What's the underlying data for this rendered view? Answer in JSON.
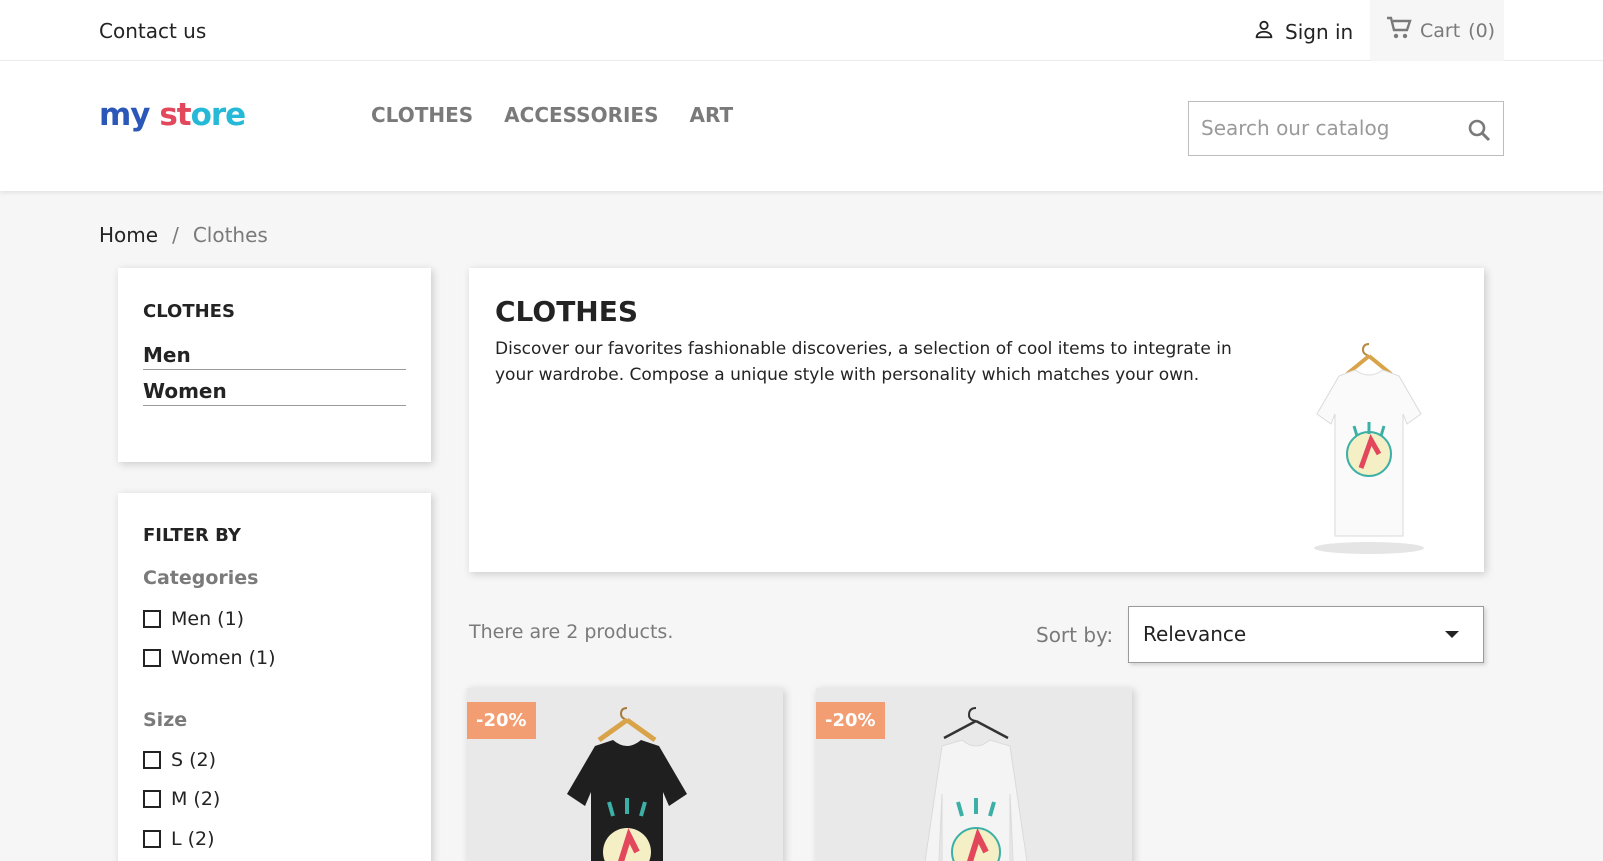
{
  "topnav": {
    "contact": "Contact us",
    "signin": "Sign in",
    "cart": "Cart",
    "cart_count": "(0)"
  },
  "header": {
    "logo": {
      "part1": "my",
      "part2": " ",
      "part3": "st",
      "part4": "ore"
    },
    "menu": [
      "CLOTHES",
      "ACCESSORIES",
      "ART"
    ],
    "search_placeholder": "Search our catalog"
  },
  "breadcrumb": {
    "home": "Home",
    "separator": "/",
    "current": "Clothes"
  },
  "categories_block": {
    "title": "CLOTHES",
    "items": [
      "Men",
      "Women"
    ]
  },
  "filters": {
    "title": "FILTER BY",
    "facets": [
      {
        "title": "Categories",
        "options": [
          "Men (1)",
          "Women (1)"
        ]
      },
      {
        "title": "Size",
        "options": [
          "S (2)",
          "M (2)",
          "L (2)"
        ]
      }
    ]
  },
  "category": {
    "title": "CLOTHES",
    "description": "Discover our favorites fashionable discoveries, a selection of cool items to integrate in your wardrobe. Compose a unique style with personality which matches your own."
  },
  "listing": {
    "count_text": "There are 2 products.",
    "sort_label": "Sort by:",
    "sort_value": "Relevance",
    "products": [
      {
        "badge": "-20%",
        "shirt_color": "#1f1f1f"
      },
      {
        "badge": "-20%",
        "shirt_color": "#f4f4f4"
      }
    ]
  },
  "colors": {
    "accent": "#25b9d7",
    "discount_badge": "#f39d72",
    "text": "#232323",
    "muted": "#7a7a7a"
  }
}
